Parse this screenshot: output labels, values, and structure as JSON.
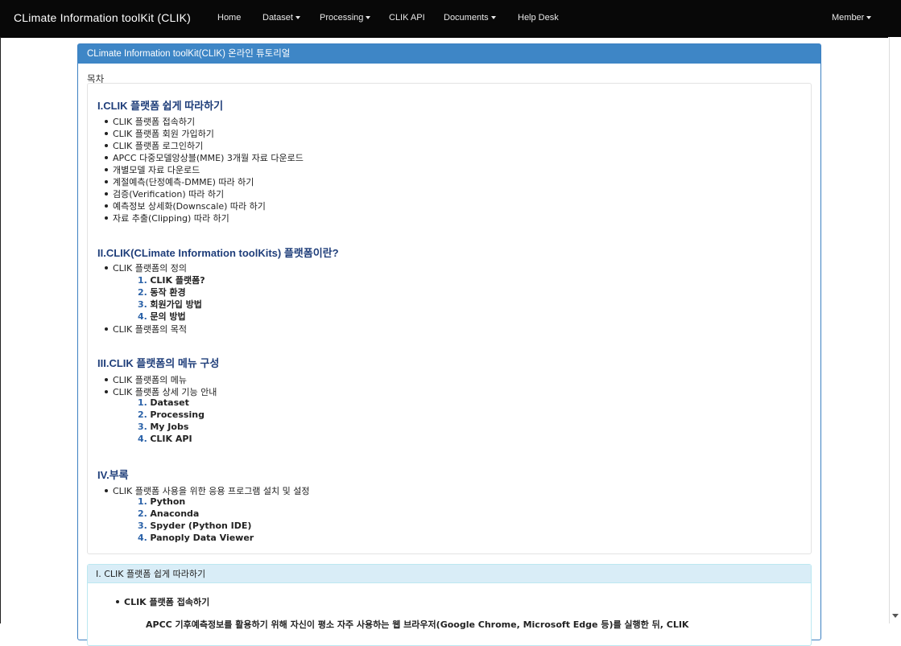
{
  "navbar": {
    "brand": "CLimate Information toolKit (CLIK)",
    "items": [
      "Home",
      "Dataset",
      "Processing",
      "CLIK API",
      "Documents",
      "Help Desk"
    ],
    "member": "Member"
  },
  "panel": {
    "title": "CLimate Information toolKit(CLIK) 온라인 튜토리얼",
    "toc_label": "목차"
  },
  "toc": {
    "s1": {
      "title": "I.CLIK 플랫폼 쉽게 따라하기",
      "items": [
        "CLIK 플랫폼 접속하기",
        "CLIK 플랫폼 회원 가입하기",
        "CLIK 플랫폼 로그인하기",
        "APCC 다중모델앙상블(MME) 3개월 자료 다운로드",
        "개별모델 자료 다운로드",
        "계절예측(단정예측-DMME) 따라 하기",
        "검증(Verification) 따라 하기",
        "예측정보 상세화(Downscale) 따라 하기",
        "자료 추출(Clipping) 따라 하기"
      ]
    },
    "s2": {
      "title": "II.CLIK(CLimate Information toolKits) 플랫폼이란?",
      "b1": "CLIK 플랫폼의 정의",
      "sub": [
        "CLIK 플랫폼?",
        "동작 환경",
        "회원가입 방법",
        "문의 방법"
      ],
      "b2": "CLIK 플랫폼의 목적"
    },
    "s3": {
      "title": "III.CLIK 플랫폼의 메뉴 구성",
      "b1": "CLIK 플랫폼의 메뉴",
      "b2": "CLIK 플랫폼 상세 기능 안내",
      "sub": [
        "Dataset",
        "Processing",
        "My Jobs",
        "CLIK API"
      ]
    },
    "s4": {
      "title": "IV.부록",
      "b1": "CLIK 플랫폼 사용을 위한 응용 프로그램 설치 및 설정",
      "sub": [
        "Python",
        "Anaconda",
        "Spyder (Python IDE)",
        "Panoply Data Viewer"
      ]
    }
  },
  "nums": [
    "1.",
    "2.",
    "3.",
    "4."
  ],
  "section1": {
    "heading": "I. CLIK 플랫폼 쉽게 따라하기",
    "bullet": "CLIK 플랫폼 접속하기",
    "paragraph": "APCC 기후예측정보를 활용하기 위해 자신이 평소 자주 사용하는 웹 브라우저(Google Chrome, Microsoft Edge 등)를 실행한 뒤, CLIK"
  },
  "colors": {
    "navbar_bg": "#080808",
    "panel_heading_bg": "#3e86c6",
    "section_title": "#1f3e7a",
    "number_color": "#2b62a8",
    "sub_heading_bg": "#d9edf7"
  }
}
